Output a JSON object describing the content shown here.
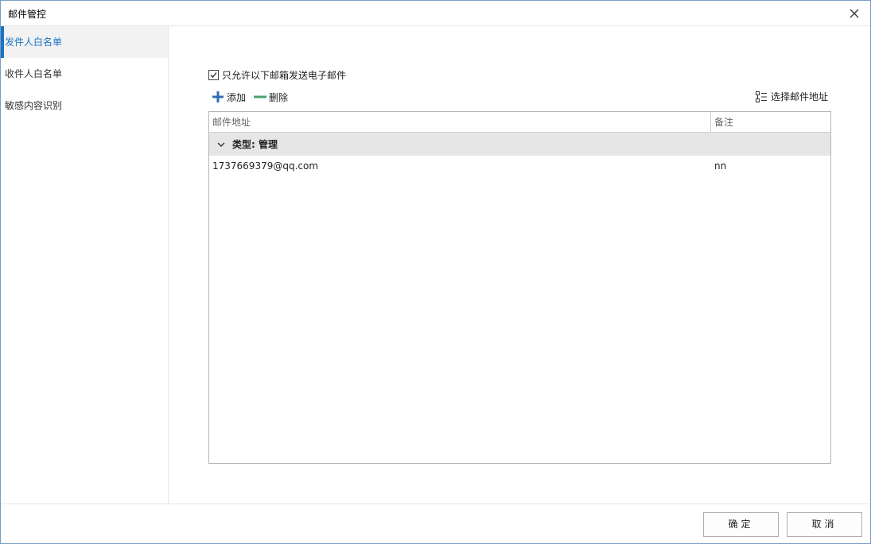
{
  "window": {
    "title": "邮件管控"
  },
  "sidebar": {
    "items": [
      {
        "label": "发件人白名单",
        "active": true
      },
      {
        "label": "收件人白名单",
        "active": false
      },
      {
        "label": "敏感内容识别",
        "active": false
      }
    ]
  },
  "main": {
    "only_allow_checkbox": {
      "label": "只允许以下邮箱发送电子邮件",
      "checked": true
    },
    "toolbar": {
      "add_label": "添加",
      "delete_label": "删除",
      "select_address_label": "选择邮件地址"
    },
    "grid": {
      "columns": [
        "邮件地址",
        "备注"
      ],
      "group": {
        "label": "类型: 管理",
        "expanded": true
      },
      "rows": [
        {
          "address": "1737669379@qq.com",
          "note": "nn"
        }
      ]
    }
  },
  "footer": {
    "ok_label": "确定",
    "cancel_label": "取消"
  },
  "colors": {
    "accent": "#1a73c4",
    "add_icon": "#2f6db4",
    "delete_icon": "#4aa36b"
  }
}
